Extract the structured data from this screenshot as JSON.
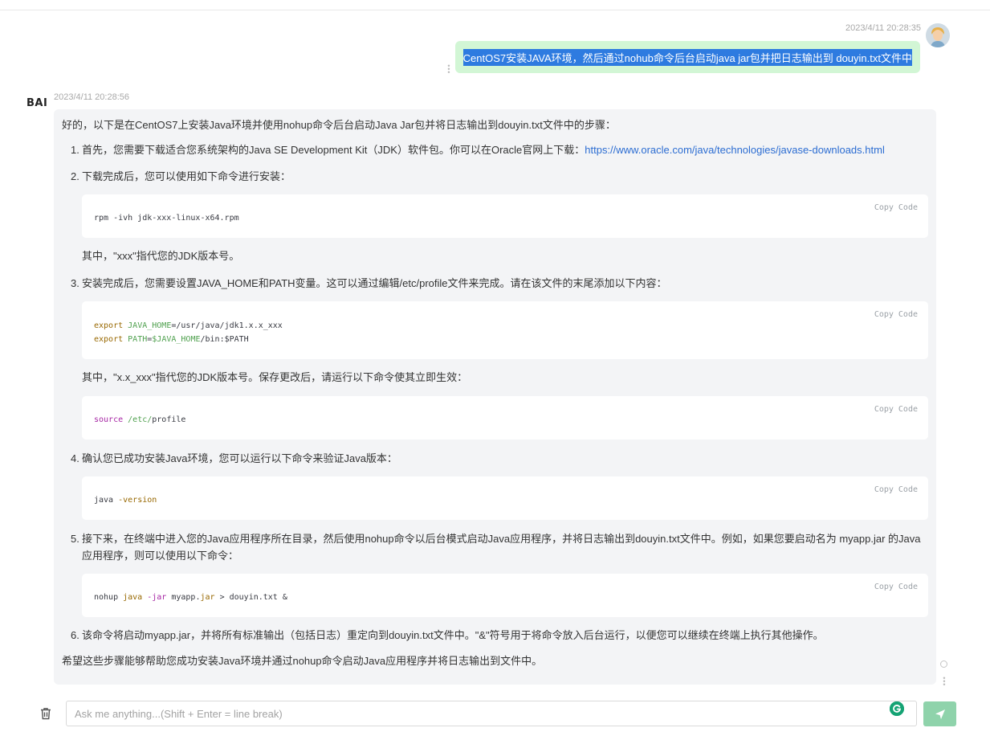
{
  "colors": {
    "user_bubble": "#d2f6d5",
    "bot_bubble": "#f3f4f6",
    "link": "#2c6dd2",
    "send_button": "#8fd3ab",
    "selection": "#2e7be0"
  },
  "user_message": {
    "time": "2023/4/11 20:28:35",
    "text": "CentOS7安装JAVA环境，然后通过nohub命令后台启动java jar包并把日志输出到 douyin.txt文件中",
    "avatar_icon": "user-avatar-icon"
  },
  "bot_message": {
    "logo": "BAI",
    "time": "2023/4/11 20:28:56",
    "intro": "好的，以下是在CentOS7上安装Java环境并使用nohup命令后台启动Java Jar包并将日志输出到douyin.txt文件中的步骤：",
    "copy_label": "Copy  Code",
    "steps": [
      {
        "num": "1.",
        "text": "首先，您需要下载适合您系统架构的Java SE Development Kit（JDK）软件包。你可以在Oracle官网上下载：",
        "link": "https://www.oracle.com/java/technologies/javase-downloads.html"
      },
      {
        "num": "2.",
        "text": "下载完成后，您可以使用如下命令进行安装：",
        "code": {
          "l1": "rpm -ivh jdk-xxx-linux-x64.rpm"
        },
        "after": "其中，\"xxx\"指代您的JDK版本号。"
      },
      {
        "num": "3.",
        "text": "安装完成后，您需要设置JAVA_HOME和PATH变量。这可以通过编辑/etc/profile文件来完成。请在该文件的末尾添加以下内容：",
        "code": {
          "l1_kw": "export",
          "l1_var": "JAVA_HOME",
          "l1_rest": "=/usr/java/jdk1.x.x_xxx",
          "l2_kw": "export",
          "l2_var": "PATH",
          "l2_eq": "=",
          "l2_var2": "$JAVA_HOME",
          "l2_rest": "/bin:$PATH"
        },
        "after": "其中，\"x.x_xxx\"指代您的JDK版本号。保存更改后，请运行以下命令使其立即生效：",
        "code2": {
          "kw": "source",
          "path": "/etc/",
          "rest": "profile"
        }
      },
      {
        "num": "4.",
        "text": "确认您已成功安装Java环境，您可以运行以下命令来验证Java版本：",
        "code": {
          "cmd": "java",
          "flag": "-version"
        }
      },
      {
        "num": "5.",
        "text": "接下来，在终端中进入您的Java应用程序所在目录，然后使用nohup命令以后台模式启动Java应用程序，并将日志输出到douyin.txt文件中。例如，如果您要启动名为 myapp.jar 的Java应用程序，则可以使用以下命令：",
        "code": {
          "p1": "nohup ",
          "p2": "java",
          "p3": " -jar",
          "p4": " myapp.",
          "p5": "jar",
          "p6": " > douyin.txt &"
        }
      },
      {
        "num": "6.",
        "text": "该命令将启动myapp.jar，并将所有标准输出（包括日志）重定向到douyin.txt文件中。\"&\"符号用于将命令放入后台运行，以便您可以继续在终端上执行其他操作。"
      }
    ],
    "ending": "希望这些步骤能够帮助您成功安装Java环境并通过nohup命令启动Java应用程序并将日志输出到文件中。"
  },
  "input": {
    "placeholder": "Ask me anything...(Shift + Enter = line break)",
    "value": ""
  },
  "icons": {
    "trash": "trash-icon",
    "grammarly": "grammarly-icon",
    "send": "send-icon"
  }
}
